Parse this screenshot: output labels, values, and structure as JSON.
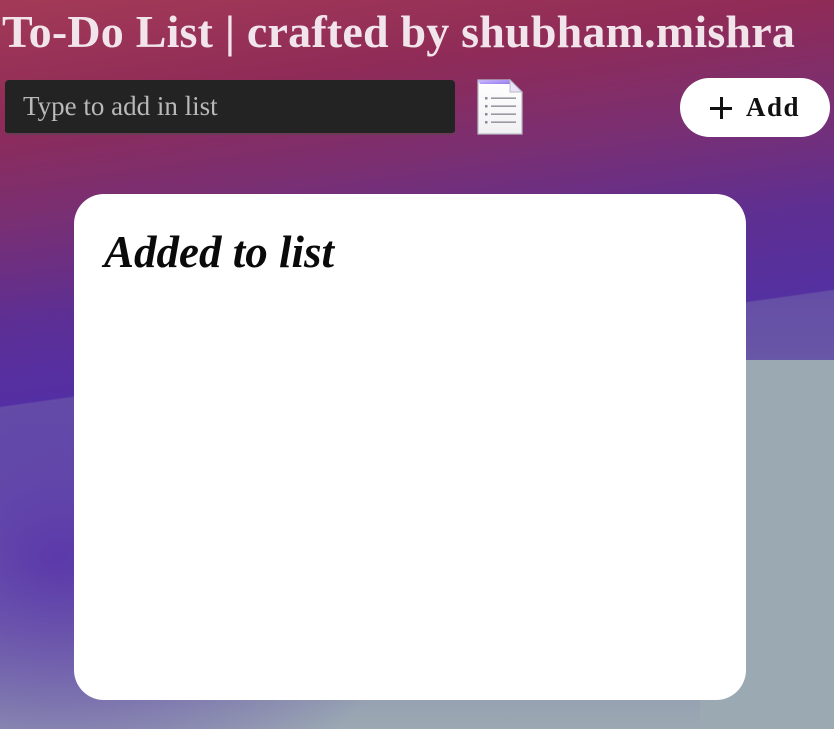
{
  "header": {
    "title": "To-Do List | crafted by shubham.mishra"
  },
  "input": {
    "placeholder": "Type to add in list",
    "value": ""
  },
  "icons": {
    "list_icon": "document-list-icon",
    "add_icon": "plus-icon"
  },
  "add_button": {
    "label": "Add"
  },
  "list": {
    "heading": "Added to list",
    "items": []
  },
  "colors": {
    "title_text": "#f1e4ea",
    "input_bg": "#232323",
    "card_bg": "#ffffff",
    "gradient_top": "#a33a57",
    "gradient_mid": "#5430a0",
    "gradient_bottom_right": "#9aa9b2"
  }
}
